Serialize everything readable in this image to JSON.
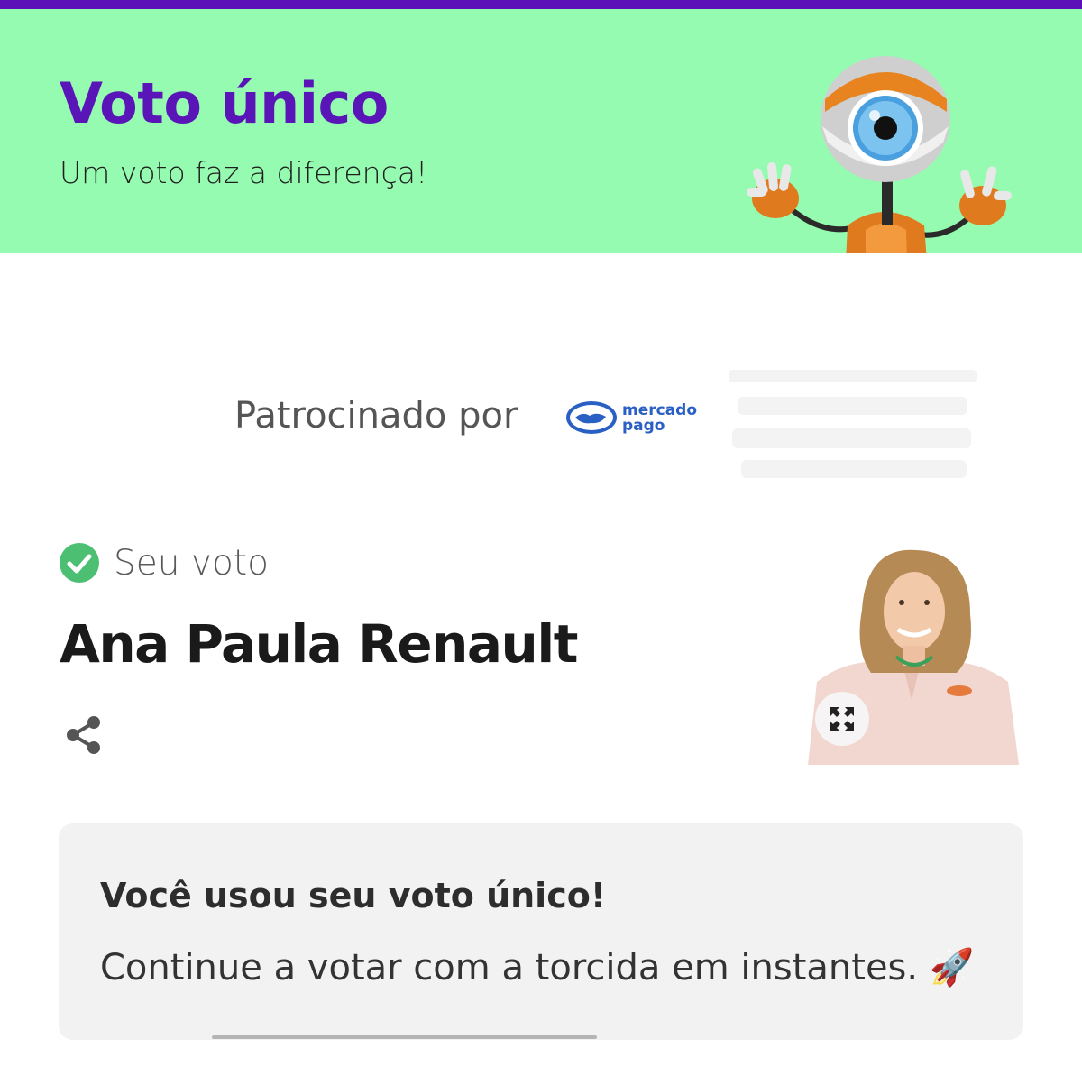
{
  "colors": {
    "top_bar": "#5b11b7",
    "header_background": "#95fbb0",
    "title_color": "#5a15b8",
    "check_color": "#4cbf72",
    "notice_background": "#f2f2f2"
  },
  "header": {
    "title": "Voto único",
    "subtitle": "Um voto faz a diferença!",
    "mascot_icon": "big-brother-eye-mascot"
  },
  "sponsor": {
    "label": "Patrocinado por",
    "logo_line1": "mercado",
    "logo_line2": "pago",
    "logo_icon": "handshake-icon"
  },
  "vote": {
    "label": "Seu voto",
    "status_icon": "check-circle-icon",
    "candidate": "Ana Paula Renault",
    "share_icon": "share-icon",
    "photo_expand_icon": "expand-icon"
  },
  "notice": {
    "title": "Você usou seu voto único!",
    "text": "Continue a votar com a torcida em instantes. 🚀"
  }
}
